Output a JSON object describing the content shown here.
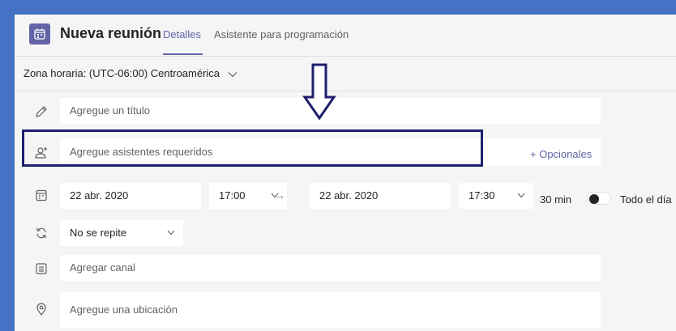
{
  "header": {
    "title": "Nueva reunión",
    "tabs": [
      {
        "label": "Detalles",
        "active": true
      },
      {
        "label": "Asistente para programación",
        "active": false
      }
    ]
  },
  "timezone": {
    "label": "Zona horaria: (UTC-06:00) Centroamérica"
  },
  "form": {
    "title_placeholder": "Agregue un título",
    "attendees_placeholder": "Agregue asistentes requeridos",
    "optional_link": "+ Opcionales",
    "start_date": "22 abr. 2020",
    "start_time": "17:00",
    "end_date": "22 abr. 2020",
    "end_time": "17:30",
    "duration": "30 min",
    "all_day_label": "Todo el día",
    "all_day_on": false,
    "repeat": "No se repite",
    "channel_placeholder": "Agregar canal",
    "location_placeholder": "Agregue una ubicación"
  },
  "colors": {
    "accent": "#6264a7",
    "frame": "#4472c4",
    "highlight": "#1f1f6e"
  }
}
